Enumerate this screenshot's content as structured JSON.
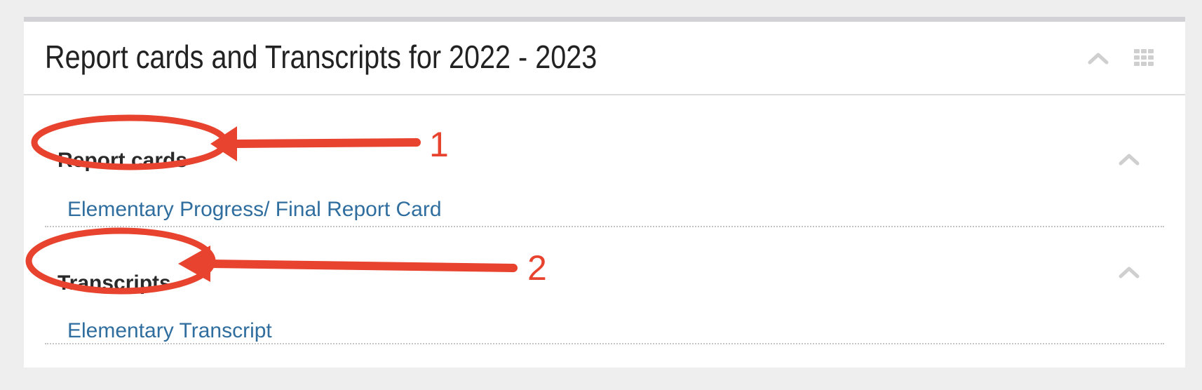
{
  "panel": {
    "title": "Report cards and Transcripts for 2022 - 2023",
    "collapse_icon": "chevron-up-icon",
    "menu_icon": "grid-icon"
  },
  "sections": [
    {
      "title": "Report cards",
      "link": "Elementary Progress/ Final Report Card",
      "toggle_icon": "chevron-up-icon"
    },
    {
      "title": "Transcripts",
      "link": "Elementary Transcript",
      "toggle_icon": "chevron-up-icon"
    }
  ],
  "annotations": {
    "color": "#e8432e",
    "labels": [
      "1",
      "2"
    ]
  },
  "colors": {
    "link": "#2f6e9e",
    "background": "#eeeeee",
    "panel_border": "#d2d2d6"
  }
}
